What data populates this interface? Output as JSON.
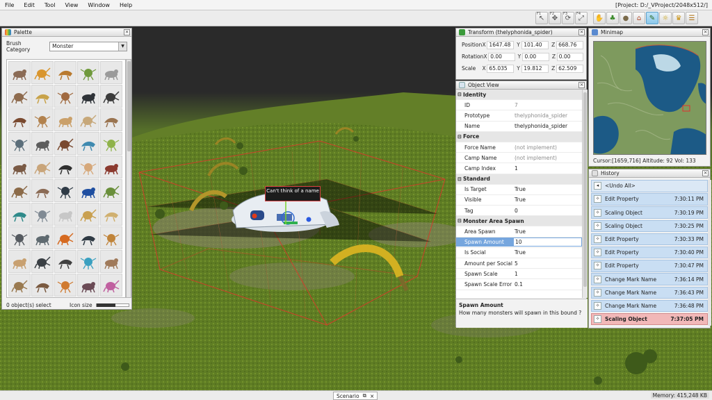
{
  "menu": {
    "items": [
      "File",
      "Edit",
      "Tool",
      "View",
      "Window",
      "Help"
    ],
    "project": "[Project: D:/_VProject/2048x512/]"
  },
  "toolbar": {
    "tools": [
      {
        "name": "select-tool",
        "fkey": "F1",
        "icon": "arrow-icon"
      },
      {
        "name": "move-tool",
        "fkey": "F2",
        "icon": "move-icon"
      },
      {
        "name": "rotate-tool",
        "fkey": "F3",
        "icon": "rotate-icon"
      },
      {
        "name": "scale-tool",
        "fkey": "F4",
        "icon": "scale-icon"
      }
    ],
    "object_tools": [
      "hand-icon",
      "tree-icon",
      "rock-icon",
      "house-icon",
      "brush-icon",
      "lightbulb-icon",
      "trophy-icon",
      "scroll-icon"
    ]
  },
  "viewport": {
    "tooltip": "Can't think of a name"
  },
  "palette": {
    "title": "Palette",
    "category_label": "Brush Category",
    "category_value": "Monster",
    "status": "0 object(s) select",
    "icon_size_label": "Icon size",
    "icon_size_value": 0.6,
    "brush_colors": [
      "#8b6b55",
      "#d9962e",
      "#b97a2e",
      "#6f9a3b",
      "#9a9a9a",
      "#8e6b4e",
      "#c8a34a",
      "#a06a40",
      "#2f3338",
      "#3b3b3b",
      "#7a4a30",
      "#b2824e",
      "#caa06a",
      "#c7a87a",
      "#9a7450",
      "#5b6e7a",
      "#5d5d5d",
      "#7a4a30",
      "#3f8ab0",
      "#8fb34a",
      "#7a5a45",
      "#c9a57a",
      "#2f2f2f",
      "#d6a87a",
      "#8b3a2f",
      "#8b6a48",
      "#8b6b55",
      "#2f3b46",
      "#1e4ea0",
      "#6a8f3b",
      "#2f8a8a",
      "#808a94",
      "#c7c7c7",
      "#c9a050",
      "#d0b070",
      "#555a60",
      "#5f6a70",
      "#d66a20",
      "#2f3a44",
      "#c0843a",
      "#c8a070",
      "#3a3f44",
      "#404040",
      "#3aa0c0",
      "#a07a5a",
      "#9a7a50",
      "#7a5a40",
      "#d07a30",
      "#6a4a55",
      "#c060a0"
    ]
  },
  "transform": {
    "title": "Transform (thelyphonida_spider)",
    "rows": [
      {
        "key": "Position",
        "x": "1647.48",
        "y": "101.40",
        "z": "668.76"
      },
      {
        "key": "Rotation",
        "x": "0.00",
        "y": "0.00",
        "z": "0.00"
      },
      {
        "key": "Scale",
        "x": "65.035",
        "y": "19.812",
        "z": "62.509"
      }
    ]
  },
  "object_view": {
    "title": "Object View",
    "rows": [
      {
        "type": "section",
        "label": "Identity"
      },
      {
        "label": "ID",
        "value": "7",
        "dim": true
      },
      {
        "label": "Prototype",
        "value": "thelyphonida_spider",
        "dim": true
      },
      {
        "label": "Name",
        "value": "thelyphonida_spider"
      },
      {
        "type": "section",
        "label": "Force"
      },
      {
        "label": "Force Name",
        "value": "(not implement)",
        "dim": true
      },
      {
        "label": "Camp Name",
        "value": "(not implement)",
        "dim": true
      },
      {
        "label": "Camp Index",
        "value": "1"
      },
      {
        "type": "section",
        "label": "Standard"
      },
      {
        "label": "Is Target",
        "value": "True"
      },
      {
        "label": "Visible",
        "value": "True"
      },
      {
        "label": "Tag",
        "value": "0"
      },
      {
        "type": "section",
        "label": "Monster Area Spawn"
      },
      {
        "label": "Area Spawn",
        "value": "True"
      },
      {
        "label": "Spawn Amount",
        "value": "10",
        "selected": true
      },
      {
        "label": "Is Social",
        "value": "True"
      },
      {
        "label": "Amount per Social",
        "value": "5"
      },
      {
        "label": "Spawn Scale",
        "value": "1"
      },
      {
        "label": "Spawn Scale Error",
        "value": "0.1"
      }
    ],
    "desc_title": "Spawn Amount",
    "desc_text": "How many monsters will spawn in this bound ?"
  },
  "minimap": {
    "title": "Minimap",
    "cursor_text": "Cursor:[1659,716] Altitude: 92  Vol: 133"
  },
  "history": {
    "title": "History",
    "items": [
      {
        "name": "<Undo All>",
        "time": "",
        "kind": "first"
      },
      {
        "name": "Edit Property",
        "time": "7:30:11 PM"
      },
      {
        "name": "Scaling Object",
        "time": "7:30:19 PM"
      },
      {
        "name": "Scaling Object",
        "time": "7:30:25 PM"
      },
      {
        "name": "Edit Property",
        "time": "7:30:33 PM"
      },
      {
        "name": "Edit Property",
        "time": "7:30:40 PM"
      },
      {
        "name": "Edit Property",
        "time": "7:30:47 PM"
      },
      {
        "name": "Change Mark Name",
        "time": "7:36:14 PM"
      },
      {
        "name": "Change Mark Name",
        "time": "7:36:43 PM"
      },
      {
        "name": "Change Mark Name",
        "time": "7:36:48 PM"
      },
      {
        "name": "Scaling Object",
        "time": "7:37:05 PM",
        "kind": "current"
      }
    ]
  },
  "status": {
    "tab": "Scenario",
    "memory": "Memory: 415,248 KB"
  },
  "colors": {
    "selection": "#76a6de",
    "history_item": "#c9def3",
    "history_current": "#f2b8b8",
    "bound_box": "#d83a2a"
  }
}
